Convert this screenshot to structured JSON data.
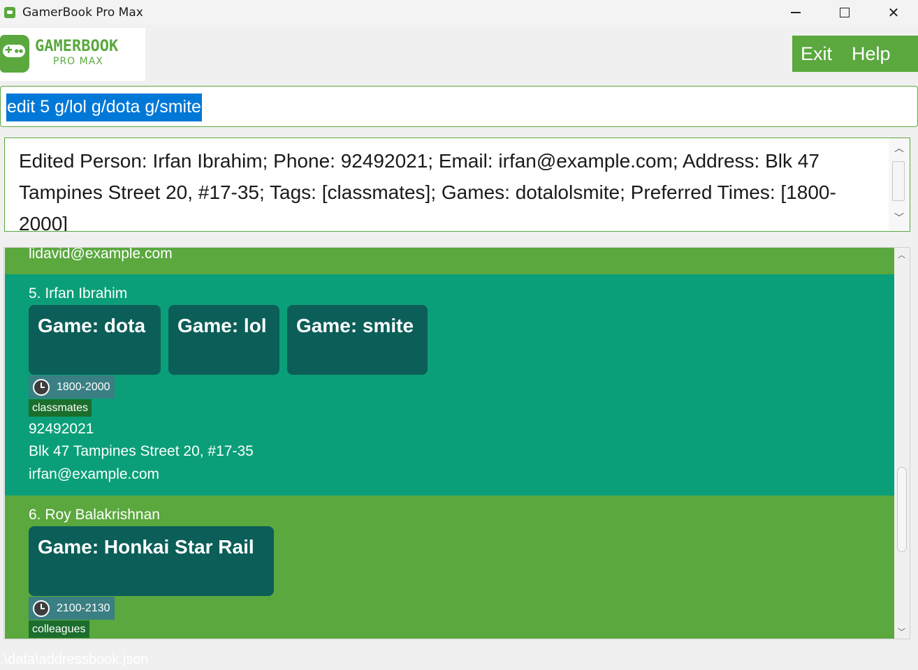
{
  "window": {
    "title": "GamerBook Pro Max",
    "controls": {
      "minimize": "minimize-icon",
      "maximize": "maximize-icon",
      "close": "✕"
    }
  },
  "logo": {
    "line1": "GAMERBOOK",
    "line2": "PRO MAX"
  },
  "menu": {
    "exit_label": "Exit",
    "help_label": "Help"
  },
  "command": {
    "value": "edit 5 g/lol g/dota g/smite"
  },
  "result": {
    "text": "Edited Person: Irfan Ibrahim; Phone: 92492021; Email: irfan@example.com; Address: Blk 47 Tampines Street 20, #17-35; Tags: [classmates]; Games: dotalolsmite; Preferred Times: [1800-2000]"
  },
  "persons": [
    {
      "partial_email": "lidavid@example.com"
    },
    {
      "name": "5. Irfan Ibrahim",
      "games": [
        "Game: dota",
        "Game: lol",
        "Game: smite"
      ],
      "time": "1800-2000",
      "tag": "classmates",
      "phone": "92492021",
      "address": "Blk 47 Tampines Street 20, #17-35",
      "email": "irfan@example.com"
    },
    {
      "name": "6. Roy Balakrishnan",
      "games": [
        "Game: Honkai Star Rail"
      ],
      "time": "2100-2130",
      "tag": "colleagues"
    }
  ],
  "status": {
    "path": ".\\data\\addressbook.json"
  },
  "colors": {
    "primary_green": "#5aa83e",
    "card_teal": "#0a9f78",
    "game_chip": "#0c5e58",
    "time_badge": "#3a7f83",
    "tag_badge": "#1b6e2c",
    "selection_blue": "#0078d7"
  }
}
